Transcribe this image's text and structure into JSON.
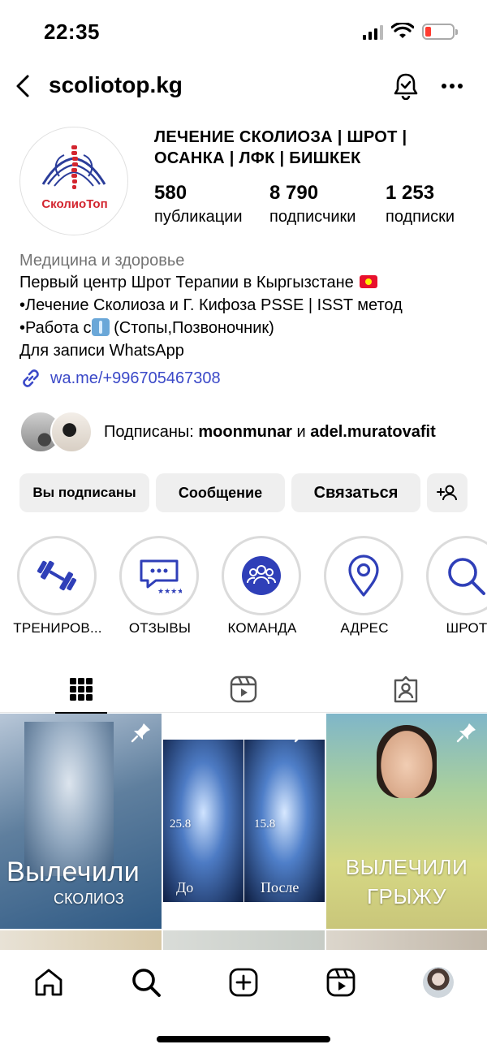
{
  "status_bar": {
    "time": "22:35"
  },
  "header": {
    "username": "scoliotop.kg"
  },
  "profile": {
    "avatar_text": "СколиоТоп",
    "name": "ЛЕЧЕНИЕ СКОЛИОЗА | ШРОТ | ОСАНКА | ЛФК | БИШКЕК",
    "stats": [
      {
        "value": "580",
        "label": "публикации"
      },
      {
        "value": "8 790",
        "label": "подписчики"
      },
      {
        "value": "1 253",
        "label": "подписки"
      }
    ]
  },
  "bio": {
    "category": "Медицина и здоровье",
    "line1": "Первый центр Шрот Терапии в Кыргызстане",
    "line2": "•Лечение Сколиоза и Г. Кифоза PSSE | ISST метод",
    "line3_prefix": "•Работа с",
    "line3_suffix": " (Стопы,Позвоночник)",
    "line4": "Для записи WhatsApp",
    "link": "wa.me/+996705467308"
  },
  "followed_by": {
    "prefix": "Подписаны: ",
    "user1": "moonmunar",
    "conj": " и ",
    "user2": "adel.muratovafit"
  },
  "buttons": {
    "following": "Вы подписаны",
    "message": "Сообщение",
    "contact": "Связаться"
  },
  "highlights": [
    {
      "label": "ТРЕНИРОВ...",
      "icon": "dumbbell-icon"
    },
    {
      "label": "ОТЗЫВЫ",
      "icon": "reviews-icon"
    },
    {
      "label": "КОМАНДА",
      "icon": "team-icon"
    },
    {
      "label": "АДРЕС",
      "icon": "location-icon"
    },
    {
      "label": "ШРОТ",
      "icon": "search-icon"
    }
  ],
  "posts": [
    {
      "line1": "Вылечили",
      "line2": "сколиоз"
    },
    {
      "left_value": "25.8",
      "right_value": "15.8",
      "left_label": "До",
      "right_label": "После"
    },
    {
      "line1": "ВЫЛЕЧИЛИ",
      "line2": "ГРЫЖУ"
    }
  ],
  "colors": {
    "accent_blue": "#2f3fb8",
    "link": "#3b49c8",
    "logo_red": "#d3252f"
  }
}
